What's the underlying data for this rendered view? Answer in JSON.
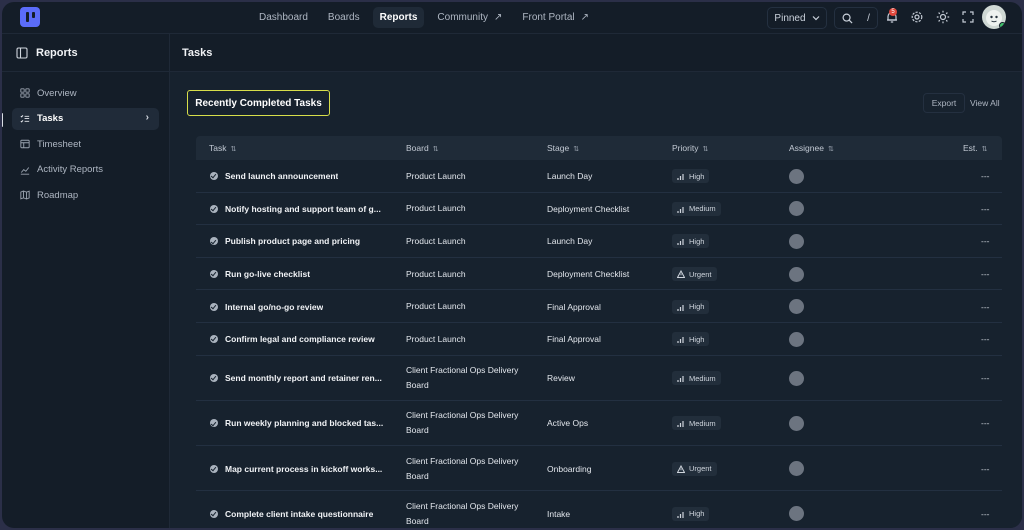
{
  "nav": {
    "items": [
      {
        "label": "Dashboard",
        "active": false,
        "external": false
      },
      {
        "label": "Boards",
        "active": false,
        "external": false
      },
      {
        "label": "Reports",
        "active": true,
        "external": false
      },
      {
        "label": "Community",
        "active": false,
        "external": true
      },
      {
        "label": "Front Portal",
        "active": false,
        "external": true
      }
    ],
    "pinned_label": "Pinned",
    "search_shortcut": "/",
    "notification_count": "5"
  },
  "sidebar": {
    "title": "Reports",
    "items": [
      {
        "label": "Overview",
        "icon": "grid-icon",
        "active": false
      },
      {
        "label": "Tasks",
        "icon": "list-check-icon",
        "active": true
      },
      {
        "label": "Timesheet",
        "icon": "timesheet-icon",
        "active": false
      },
      {
        "label": "Activity Reports",
        "icon": "chart-line-icon",
        "active": false
      },
      {
        "label": "Roadmap",
        "icon": "map-icon",
        "active": false
      }
    ]
  },
  "main": {
    "title": "Tasks",
    "card_title": "Recently Completed Tasks",
    "export_label": "Export",
    "view_all_label": "View All"
  },
  "table": {
    "columns": [
      "Task",
      "Board",
      "Stage",
      "Priority",
      "Assignee",
      "Est."
    ],
    "rows": [
      {
        "task": "Send launch announcement",
        "board": "Product Launch",
        "stage": "Launch Day",
        "priority": "High",
        "est": "---"
      },
      {
        "task": "Notify hosting and support team of g...",
        "board": "Product Launch",
        "stage": "Deployment Checklist",
        "priority": "Medium",
        "est": "---"
      },
      {
        "task": "Publish product page and pricing",
        "board": "Product Launch",
        "stage": "Launch Day",
        "priority": "High",
        "est": "---"
      },
      {
        "task": "Run go-live checklist",
        "board": "Product Launch",
        "stage": "Deployment Checklist",
        "priority": "Urgent",
        "est": "---"
      },
      {
        "task": "Internal go/no-go review",
        "board": "Product Launch",
        "stage": "Final Approval",
        "priority": "High",
        "est": "---"
      },
      {
        "task": "Confirm legal and compliance review",
        "board": "Product Launch",
        "stage": "Final Approval",
        "priority": "High",
        "est": "---"
      },
      {
        "task": "Send monthly report and retainer ren...",
        "board": "Client Fractional Ops Delivery Board",
        "stage": "Review",
        "priority": "Medium",
        "est": "---"
      },
      {
        "task": "Run weekly planning and blocked tas...",
        "board": "Client Fractional Ops Delivery Board",
        "stage": "Active Ops",
        "priority": "Medium",
        "est": "---"
      },
      {
        "task": "Map current process in kickoff works...",
        "board": "Client Fractional Ops Delivery Board",
        "stage": "Onboarding",
        "priority": "Urgent",
        "est": "---"
      },
      {
        "task": "Complete client intake questionnaire",
        "board": "Client Fractional Ops Delivery Board",
        "stage": "Intake",
        "priority": "High",
        "est": "---"
      }
    ]
  },
  "colors": {
    "accent": "#5b6cf9",
    "highlight_border": "#d7de4a",
    "notification": "#e0473c",
    "online": "#3fbf6a"
  }
}
